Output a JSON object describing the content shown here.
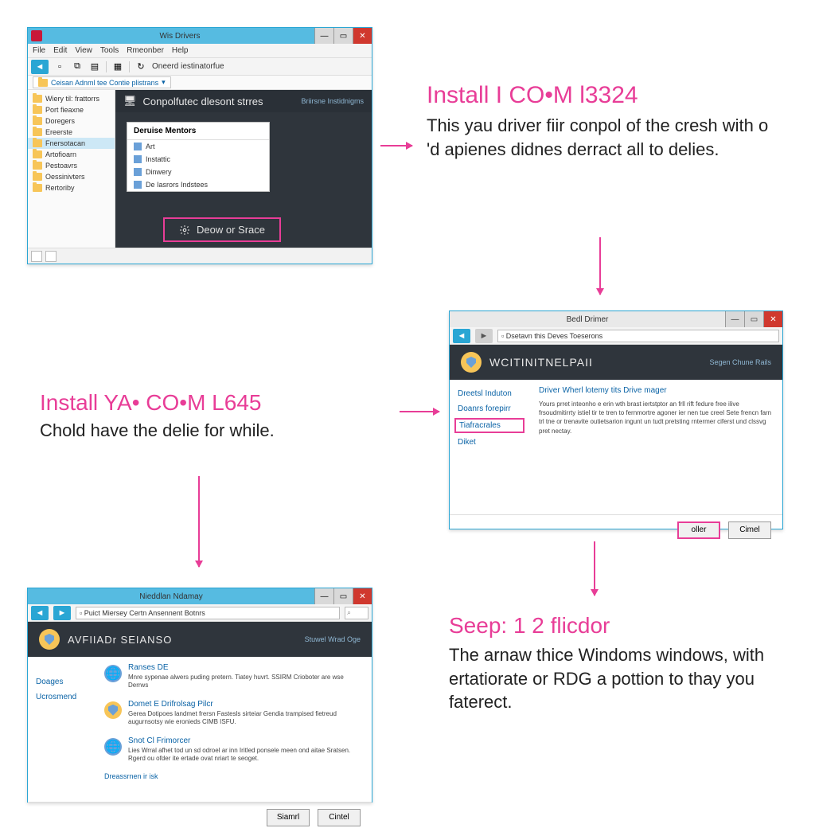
{
  "step1": {
    "title": "Install I CO•M l3324",
    "body": "This yau driver fiir conpol of the cresh with o 'd apienes didnes derract all to delies."
  },
  "step2": {
    "title": "Install YA• CO•M L645",
    "body": "Chold have the delie for while."
  },
  "step3": {
    "title": "Seep: 1 2 flicdor",
    "body": "The arnaw thice Windoms windows, with ertatiorate or RDG a pottion to thay you faterect."
  },
  "w1": {
    "title": "Wis Drivers",
    "menu": [
      "File",
      "Edit",
      "View",
      "Tools",
      "Rmeonber",
      "Help"
    ],
    "crumb": "Ceisan Adnml tee Contie plistrans",
    "sidebar": [
      "Wiery til: frattorrs",
      "Port fieaxne",
      "Doregers",
      "Ereerste",
      "Fnersotacan",
      "Artofioarn",
      "Pestoavrs",
      "Oessinivters",
      "Rertoriby"
    ],
    "header": "Conpolfutec dlesont strres",
    "header_right": "Briirsne Instidnigms",
    "panel_title": "Deruise Mentors",
    "panel_items": [
      "Art",
      "Instattic",
      "Dinwery",
      "De Iasrors Indstees"
    ],
    "button": "Deow or Srace"
  },
  "w2": {
    "title": "Bedl Drimer",
    "address": "Dsetavn this Deves Toeserons",
    "banner": "WCITINITNELPAII",
    "banner_right": "Segen Chune Rails",
    "sidebar": [
      "Dreetsl Induton",
      "Doanrs forepirr",
      "Tiafracrales",
      "Diket"
    ],
    "heading": "Driver Wherl lotemy tits Drive mager",
    "text": "Yours prret inteonho e erin wth brast iertstptor an frll rift fedure free ilive frsoudmitirrty istiel tir te tren to fernmortre agoner ier nen tue creel Sete frencn farn trl tne or trenavite outietsarion ingunt un tudt pretsting rntermer ciferst und clssvg pret nectay.",
    "ok": "oller",
    "cancel": "Cimel"
  },
  "w3": {
    "title": "Nieddlan Ndamay",
    "address": "Puict Miersey Certn Ansennent Botnrs",
    "banner": "AVFIIADr SEIANSO",
    "banner_right": "Stuwel Wrad Oge",
    "sidebar": [
      "Doages",
      "Ucrosmend"
    ],
    "items": [
      {
        "title": "Ranses DE",
        "desc": "Mnre sypenae alwers puding pretern. Tiatey huvrt. SSIRM Crioboter are wse Derrws"
      },
      {
        "title": "Domet E Drifrolsag Pilcr",
        "desc": "Gerea Dotipoes landmet frersn Fastesls sirteiar Gendia trampised fietreud augurnsotsy wie eronieds CIMB ISFU."
      },
      {
        "title": "Snot Cl Frimorcer",
        "desc": "Lies Wrral afhet tod un sd odroel ar inn Iritled ponsele meen ond aitae Sratsen. Rgerd ou ofder ite ertade ovat nriart te seoget."
      }
    ],
    "link": "Dreassrnen ir isk",
    "ok": "Siamrl",
    "cancel": "Cintel"
  }
}
